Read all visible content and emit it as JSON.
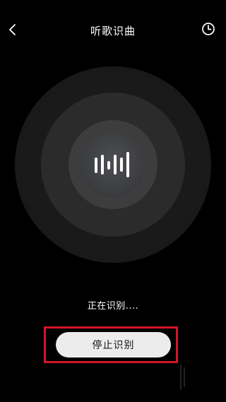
{
  "header": {
    "title": "听歌识曲",
    "back_icon": "chevron-left-icon",
    "history_icon": "clock-icon"
  },
  "visualizer": {
    "icon": "audio-wave-icon"
  },
  "status": {
    "text": "正在识别...."
  },
  "actions": {
    "stop_label": "停止识别"
  },
  "colors": {
    "background": "#000000",
    "highlight": "#d3152a",
    "button": "#ececec"
  }
}
